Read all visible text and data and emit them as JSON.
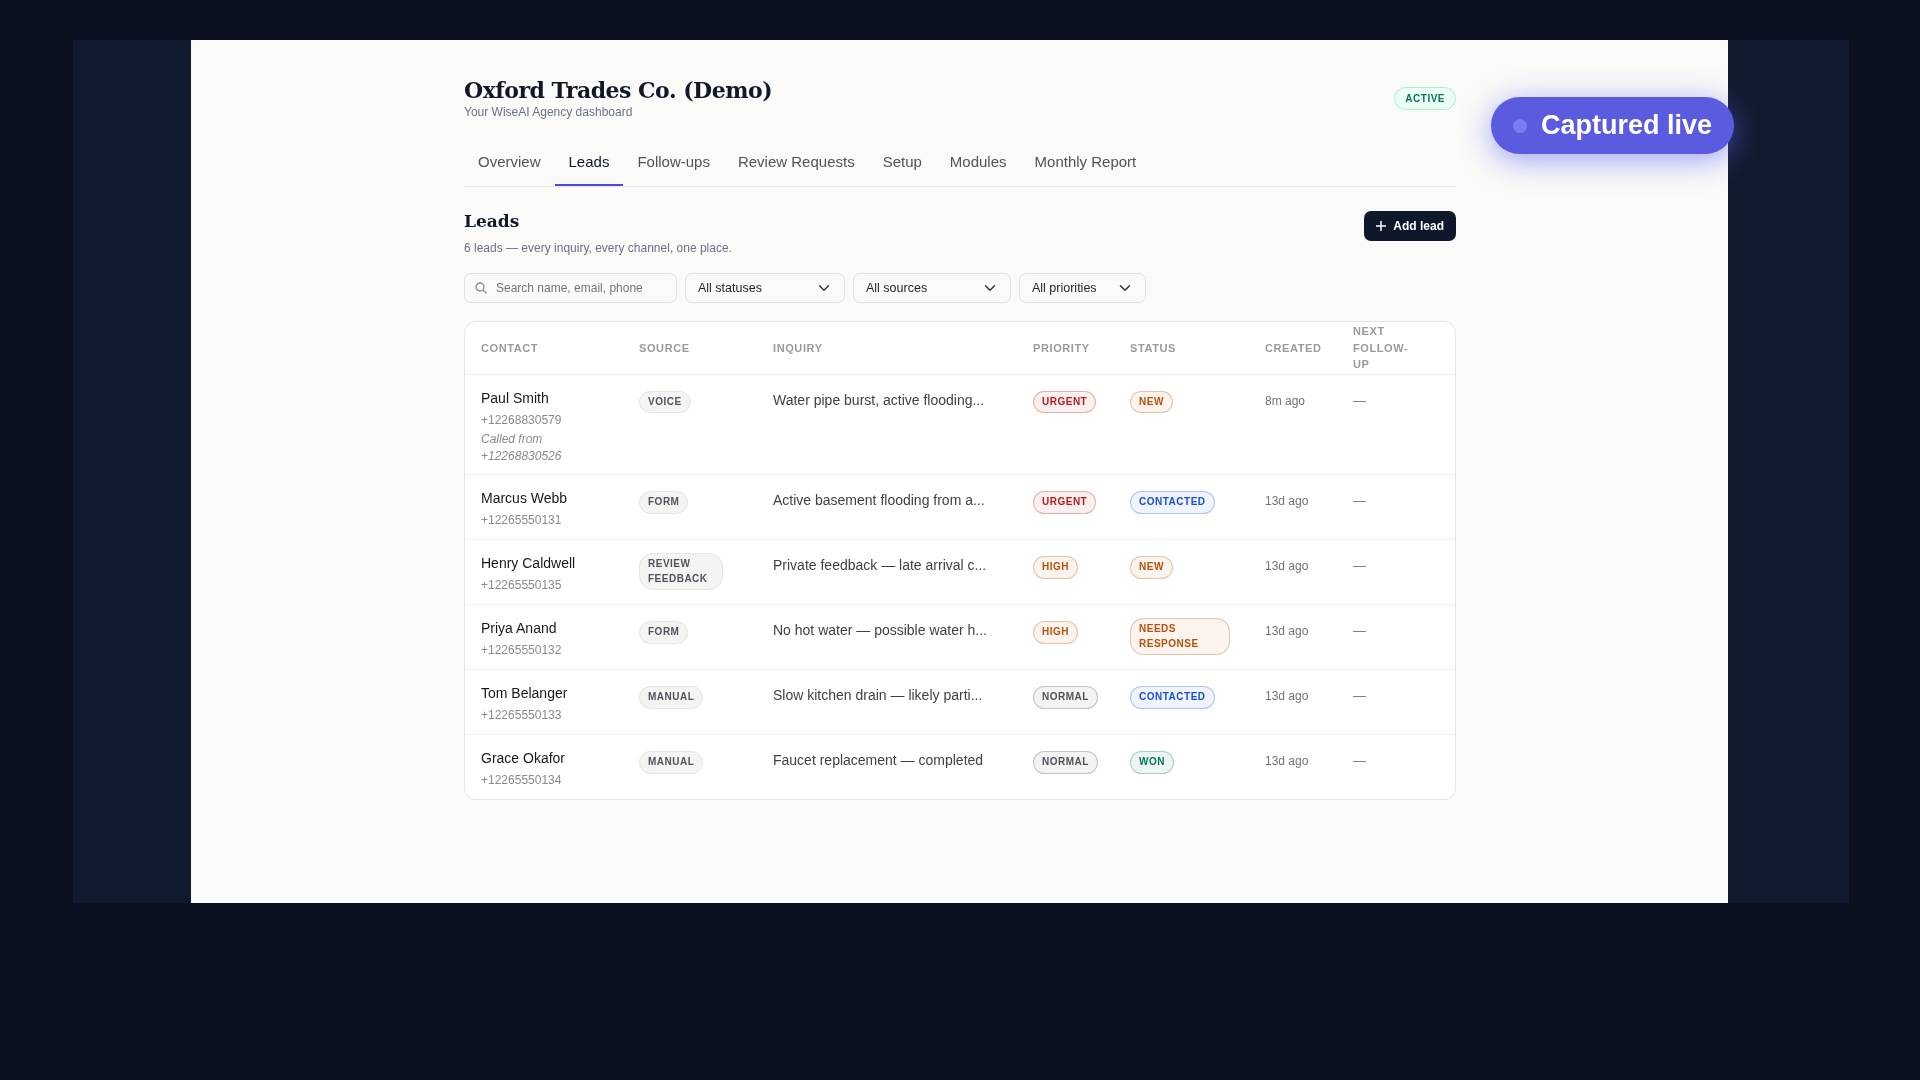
{
  "header": {
    "title": "Oxford Trades Co. (Demo)",
    "subtitle": "Your WiseAI Agency dashboard",
    "status_badge": "ACTIVE"
  },
  "capture_badge": {
    "label": "Captured live"
  },
  "tabs": [
    {
      "label": "Overview",
      "selected": false
    },
    {
      "label": "Leads",
      "selected": true
    },
    {
      "label": "Follow-ups",
      "selected": false
    },
    {
      "label": "Review Requests",
      "selected": false
    },
    {
      "label": "Setup",
      "selected": false
    },
    {
      "label": "Modules",
      "selected": false
    },
    {
      "label": "Monthly Report",
      "selected": false
    }
  ],
  "section": {
    "title": "Leads",
    "subtitle": "6 leads — every inquiry, every channel, one place.",
    "add_button": "Add lead"
  },
  "filters": {
    "search": {
      "placeholder": "Search name, email, phone"
    },
    "selects": [
      "All statuses",
      "All sources",
      "All priorities"
    ]
  },
  "table": {
    "columns": [
      "CONTACT",
      "SOURCE",
      "INQUIRY",
      "PRIORITY",
      "STATUS",
      "CREATED",
      "NEXT FOLLOW-UP"
    ],
    "rows": [
      {
        "name": "Paul Smith",
        "phone": "+12268830579",
        "note": "Called from +12268830526",
        "source": "VOICE",
        "inquiry": "Water pipe burst, active flooding...",
        "priority": {
          "label": "URGENT",
          "color": "#b91c1c"
        },
        "status": {
          "label": "NEW",
          "color": "#b45309"
        },
        "created": "8m ago",
        "next_followup": "—"
      },
      {
        "name": "Marcus Webb",
        "phone": "+12265550131",
        "source": "FORM",
        "inquiry": "Active basement flooding from a...",
        "priority": {
          "label": "URGENT",
          "color": "#b91c1c"
        },
        "status": {
          "label": "CONTACTED",
          "color": "#1d4ed8"
        },
        "created": "13d ago",
        "next_followup": "—"
      },
      {
        "name": "Henry Caldwell",
        "phone": "+12265550135",
        "source": "REVIEW FEEDBACK",
        "inquiry": "Private feedback — late arrival c...",
        "priority": {
          "label": "HIGH",
          "color": "#b45309"
        },
        "status": {
          "label": "NEW",
          "color": "#b45309"
        },
        "created": "13d ago",
        "next_followup": "—"
      },
      {
        "name": "Priya Anand",
        "phone": "+12265550132",
        "source": "FORM",
        "inquiry": "No hot water — possible water h...",
        "priority": {
          "label": "HIGH",
          "color": "#b45309"
        },
        "status": {
          "label": "NEEDS RESPONSE",
          "color": "#b45309"
        },
        "created": "13d ago",
        "next_followup": "—"
      },
      {
        "name": "Tom Belanger",
        "phone": "+12265550133",
        "source": "MANUAL",
        "inquiry": "Slow kitchen drain — likely parti...",
        "priority": {
          "label": "NORMAL",
          "color": "#52525b"
        },
        "status": {
          "label": "CONTACTED",
          "color": "#1d4ed8"
        },
        "created": "13d ago",
        "next_followup": "—"
      },
      {
        "name": "Grace Okafor",
        "phone": "+12265550134",
        "source": "MANUAL",
        "inquiry": "Faucet replacement — completed",
        "priority": {
          "label": "NORMAL",
          "color": "#52525b"
        },
        "status": {
          "label": "WON",
          "color": "#047857"
        },
        "created": "13d ago",
        "next_followup": "—"
      }
    ]
  }
}
